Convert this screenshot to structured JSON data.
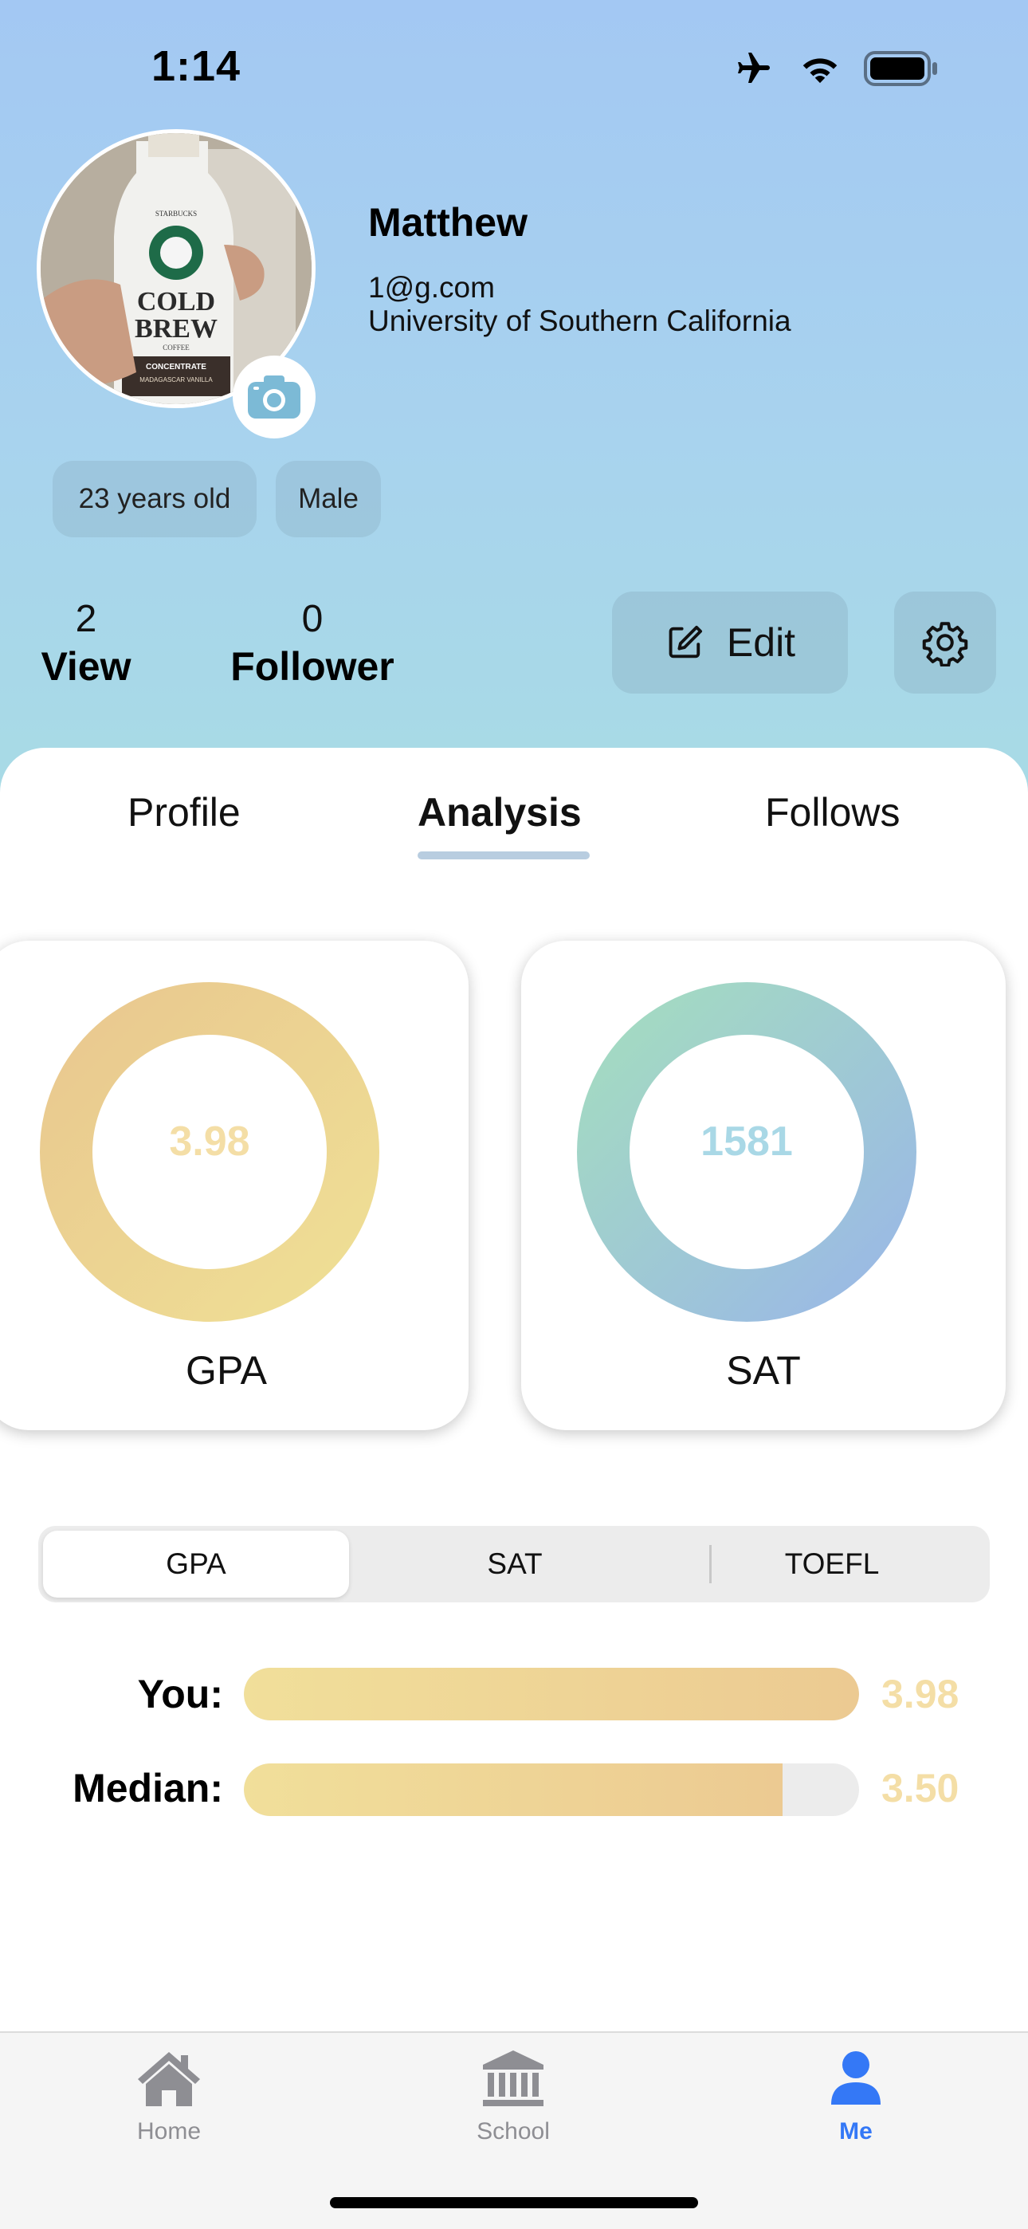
{
  "status_bar": {
    "time": "1:14",
    "icons": [
      "airplane-icon",
      "wifi-icon",
      "battery-icon"
    ]
  },
  "profile": {
    "name": "Matthew",
    "email": "1@g.com",
    "school": "University of Southern California",
    "chips": [
      "23 years old",
      "Male"
    ],
    "avatar_bottle_text": [
      "STARBUCKS",
      "COLD",
      "BREW",
      "COFFEE",
      "CONCENTRATE",
      "MADAGASCAR VANILLA"
    ]
  },
  "stats": {
    "views": {
      "value": "2",
      "label": "View"
    },
    "followers": {
      "value": "0",
      "label": "Follower"
    }
  },
  "actions": {
    "edit_label": "Edit"
  },
  "tabs": {
    "items": [
      "Profile",
      "Analysis",
      "Follows"
    ],
    "active": "Analysis"
  },
  "cards": {
    "gpa": {
      "value": "3.98",
      "label": "GPA",
      "value_color": "#f4dea6"
    },
    "sat": {
      "value": "1581",
      "label": "SAT",
      "value_color": "#a9d8e6"
    }
  },
  "segmented": {
    "items": [
      "GPA",
      "SAT",
      "TOEFL"
    ],
    "active": "GPA"
  },
  "comparison": {
    "you": {
      "label": "You:",
      "value": "3.98",
      "fraction": 1.0
    },
    "median": {
      "label": "Median:",
      "value": "3.50",
      "fraction": 0.875
    }
  },
  "tabbar": {
    "items": [
      {
        "label": "Home",
        "icon": "house-icon",
        "color": "#8e8e93"
      },
      {
        "label": "School",
        "icon": "institution-icon",
        "color": "#8e8e93"
      },
      {
        "label": "Me",
        "icon": "person-icon",
        "color": "#3478f6"
      }
    ],
    "active": "Me"
  },
  "colors": {
    "accent": "#3478f6",
    "gpa_gradient": [
      "#e9c88f",
      "#efdf95"
    ],
    "sat_gradient": [
      "#a4dcc0",
      "#9ab8e6"
    ]
  }
}
